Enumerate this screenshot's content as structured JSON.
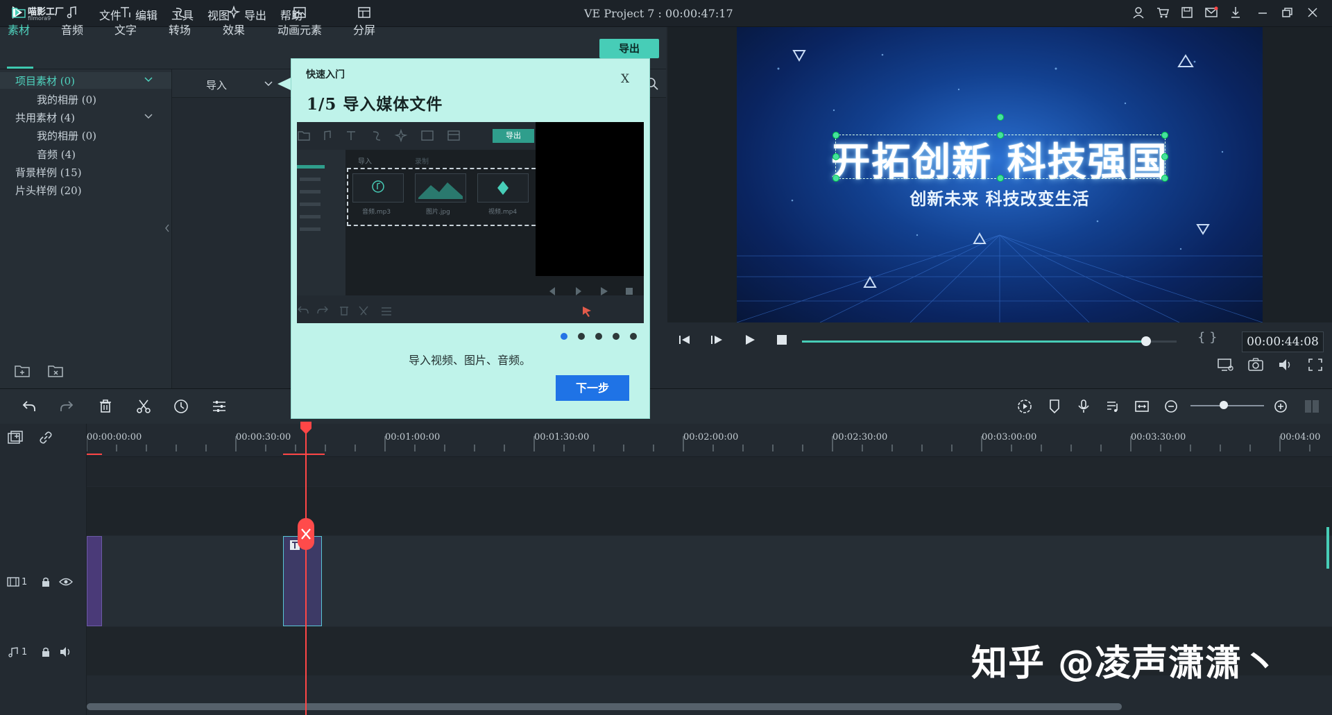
{
  "app": {
    "logo_text": "喵影工厂",
    "logo_sub": "filmora9",
    "project_title": "VE Project 7 : 00:00:47:17"
  },
  "menu": [
    "文件",
    "编辑",
    "工具",
    "视图",
    "导出",
    "帮助"
  ],
  "media_tabs": [
    {
      "label": "素材",
      "icon": "folder-icon"
    },
    {
      "label": "音频",
      "icon": "music-note-icon"
    },
    {
      "label": "文字",
      "icon": "text-icon"
    },
    {
      "label": "转场",
      "icon": "transition-icon"
    },
    {
      "label": "效果",
      "icon": "effects-icon"
    },
    {
      "label": "动画元素",
      "icon": "image-icon"
    },
    {
      "label": "分屏",
      "icon": "split-screen-icon"
    }
  ],
  "export_label": "导出",
  "tree": [
    {
      "label": "项目素材 (0)",
      "indent": 0,
      "selected": true,
      "expandable": true
    },
    {
      "label": "我的相册 (0)",
      "indent": 1
    },
    {
      "label": "共用素材 (4)",
      "indent": 0,
      "expandable": true
    },
    {
      "label": "我的相册 (0)",
      "indent": 1
    },
    {
      "label": "音频 (4)",
      "indent": 1
    },
    {
      "label": "背景样例 (15)",
      "indent": 0
    },
    {
      "label": "片头样例 (20)",
      "indent": 0
    }
  ],
  "media_import_label": "导入",
  "preview": {
    "title": "开拓创新 科技强国",
    "subtitle": "创新未来 科技改变生活",
    "timecode": "00:00:44:08",
    "progress": 0.918,
    "brace_label": "{ }"
  },
  "timeline": {
    "ruler": [
      "00:00:00:00",
      "00:00:30:00",
      "00:01:00:00",
      "00:01:30:00",
      "00:02:00:00",
      "00:02:30:00",
      "00:03:00:00",
      "00:03:30:00",
      "00:04:00"
    ],
    "video_track_label": "1",
    "audio_track_label": "1",
    "zoom": 0.45
  },
  "dialog": {
    "title": "快速入门",
    "close": "X",
    "heading": "1/5 导入媒体文件",
    "description": "导入视频、图片、音频。",
    "next_label": "下一步",
    "steps_total": 5,
    "step_current": 1,
    "shot": {
      "export": "导出",
      "import": "导入",
      "record": "录制",
      "files": [
        "音频.mp3",
        "图片.jpg",
        "视频.mp4"
      ]
    }
  },
  "watermark": "知乎 @凌声潇潇丶",
  "colors": {
    "accent": "#47cdb7",
    "dialog_bg": "#bff3ea",
    "next_button": "#1f73e6",
    "playhead": "#ff4646"
  }
}
